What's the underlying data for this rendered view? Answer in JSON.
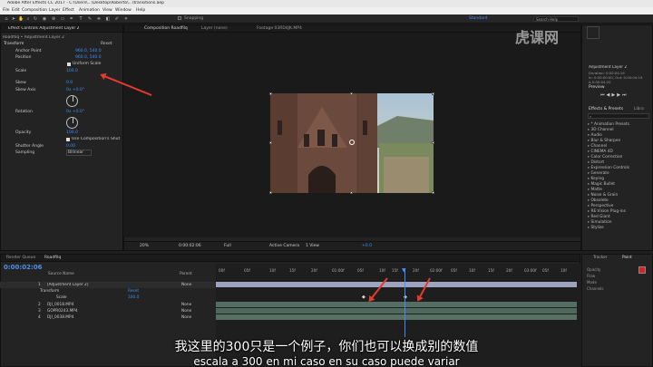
{
  "window": {
    "title": "Adobe After Effects CC 2017 - C:\\Users\\...\\Desktop\\Roberto\\...\\transitions.aep"
  },
  "menu": [
    "File",
    "Edit",
    "Composition",
    "Layer",
    "Effect",
    "Animation",
    "View",
    "Window",
    "Help"
  ],
  "toolbar": {
    "snapping": "Snapping",
    "workspace": "Standard",
    "search_placeholder": "Search Help"
  },
  "effect_controls": {
    "tab": "Effect Controls Adjustment Layer 2",
    "breadcrumb": "Roadfilq • Adjustment Layer 2",
    "section": "Transform",
    "reset": "Reset",
    "props": [
      {
        "label": "Anchor Point",
        "value": "960.0, 540.0"
      },
      {
        "label": "Position",
        "value": "960.0, 540.0"
      },
      {
        "label": "Uniform Scale",
        "value": ""
      },
      {
        "label": "Scale",
        "value": "100.0"
      },
      {
        "label": "Skew",
        "value": "0.0"
      },
      {
        "label": "Skew Axis",
        "value": "0x +0.0°"
      },
      {
        "label": "Rotation",
        "value": "0x +0.0°"
      },
      {
        "label": "Opacity",
        "value": "100.0"
      },
      {
        "label": "Use Composition's Shut",
        "value": ""
      },
      {
        "label": "Shutter Angle",
        "value": "0.00"
      },
      {
        "label": "Sampling",
        "value": "Bilinear"
      }
    ]
  },
  "viewer": {
    "tabs": [
      "Composition Roadfilq",
      "Layer (none)",
      "Footage 03RD4JK.MP4"
    ],
    "sub_tab": "Roadfilq",
    "camera": "Active Camera",
    "zoom": "20%",
    "timecode": "0:00:02:06",
    "resolution": "Full",
    "view": "Active Camera",
    "views": "1 View",
    "offset": "+0.0"
  },
  "info_panel": {
    "layer": "Adjustment Layer 2",
    "lines": [
      "Duration: 0:00:04:19",
      "In: 0:00:00:00, Out: 0:00:04:19",
      "Δ 0:00:04:20"
    ]
  },
  "preview": {
    "title": "Preview"
  },
  "effects_presets": {
    "title": "Effects & Presets",
    "libraries": "Libra",
    "items": [
      "* Animation Presets",
      "3D Channel",
      "Audio",
      "Blur & Sharpen",
      "Channel",
      "CINEMA 4D",
      "Color Correction",
      "Distort",
      "Expression Controls",
      "Generate",
      "Keying",
      "Magic Bullet",
      "Matte",
      "Noise & Grain",
      "Obsolete",
      "Perspective",
      "RE:Vision Plug-ins",
      "Red Giant",
      "Simulation",
      "Stylize"
    ]
  },
  "timeline": {
    "tabs": [
      "Render Queue",
      "Roadfilq"
    ],
    "timecode": "0:00:02:06",
    "column_header": "Source Name",
    "parent_header": "Parent",
    "ruler": [
      "00f",
      "05f",
      "10f",
      "15f",
      "20f",
      "01:00f",
      "05f",
      "10f",
      "15f",
      "20f",
      "02:00f",
      "05f",
      "10f",
      "15f",
      "20f",
      "03:00f",
      "05f",
      "10f",
      "15f",
      "20f"
    ],
    "layers": [
      {
        "num": "1",
        "name": "[Adjustment Layer 2]",
        "parent": "None"
      },
      {
        "num": "",
        "name": "Transform",
        "parent": "Reset"
      },
      {
        "num": "",
        "name": "Scale",
        "parent": "100.0"
      },
      {
        "num": "2",
        "name": "DJI_0018.MP4",
        "parent": "None"
      },
      {
        "num": "3",
        "name": "GOPR0243.MP4",
        "parent": "None"
      },
      {
        "num": "4",
        "name": "DJI_0038.MP4",
        "parent": "None"
      }
    ]
  },
  "right_tools": {
    "tabs": [
      "Tracker",
      "Paint"
    ],
    "opacity": "Opacity",
    "flow": "Flow",
    "mode": "Mode",
    "channels": "Channels"
  },
  "subtitles": {
    "cn": "我这里的300只是一个例子，你们也可以换成别的数值",
    "es": "escala a 300 en mi caso en su caso puede variar"
  },
  "watermark": "虎课网",
  "colors": {
    "accent": "#3d8ef5",
    "annotation": "#e53b2c",
    "paint_fg": "#e02020"
  }
}
